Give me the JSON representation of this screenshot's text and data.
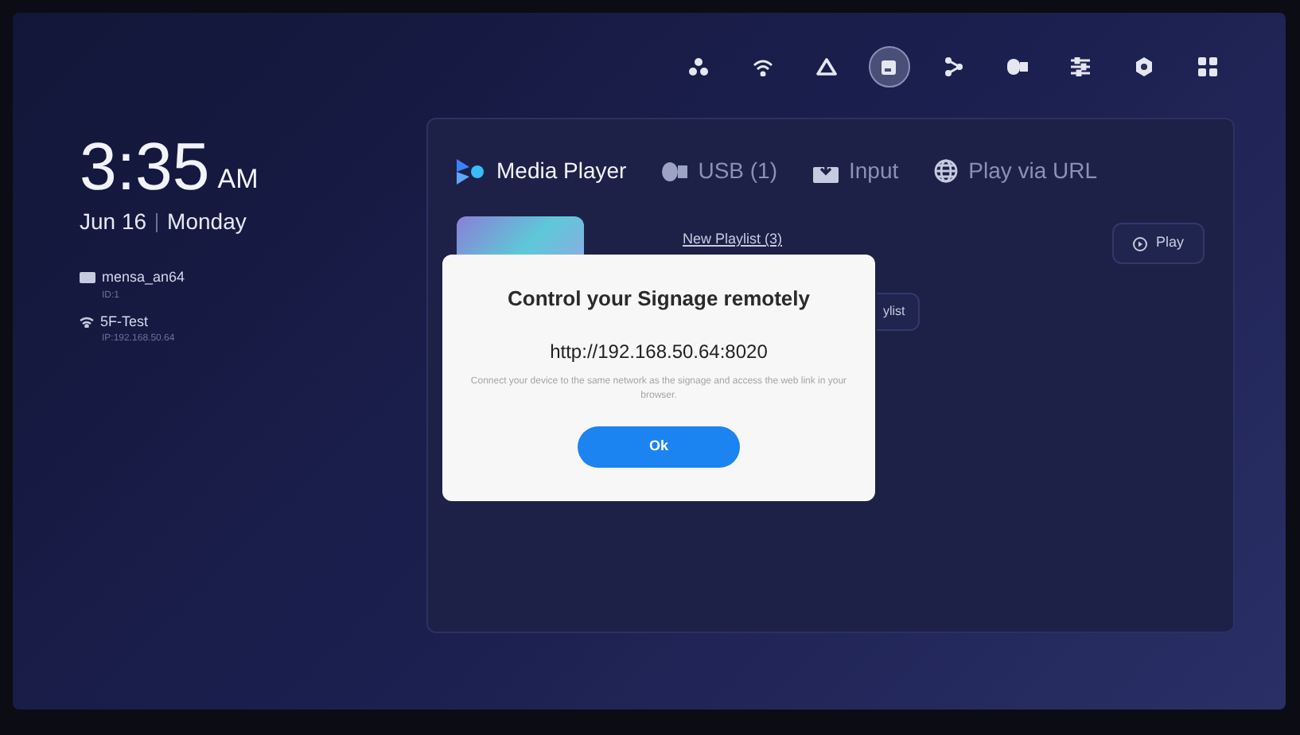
{
  "status_icons": [
    {
      "kind": "network",
      "selected": false
    },
    {
      "kind": "wifi",
      "selected": false
    },
    {
      "kind": "triangle",
      "selected": false
    },
    {
      "kind": "cast",
      "selected": true
    },
    {
      "kind": "share",
      "selected": false
    },
    {
      "kind": "usb",
      "selected": false
    },
    {
      "kind": "sliders",
      "selected": false
    },
    {
      "kind": "gear",
      "selected": false
    },
    {
      "kind": "grid",
      "selected": false
    }
  ],
  "clock": {
    "time": "3:35",
    "ampm": "AM",
    "date": "Jun 16",
    "weekday": "Monday"
  },
  "device": {
    "name": "mensa_an64",
    "id": "ID:1"
  },
  "network": {
    "name": "5F-Test",
    "ip": "IP:192.168.50.64"
  },
  "tabs": [
    {
      "label": "Media Player",
      "kind": "media",
      "selected": true
    },
    {
      "label": "USB (1)",
      "kind": "usb",
      "selected": false
    },
    {
      "label": "Input",
      "kind": "input",
      "selected": false
    },
    {
      "label": "Play via URL",
      "kind": "globe",
      "selected": false
    }
  ],
  "playlist": {
    "title": "New Playlist (3)",
    "play": "Play",
    "button_2": "ylist"
  },
  "dialog": {
    "title": "Control your Signage remotely",
    "url": "http://192.168.50.64:8020",
    "message": "Connect your device to the same network as the signage and access the web link in your browser.",
    "ok": "Ok"
  }
}
